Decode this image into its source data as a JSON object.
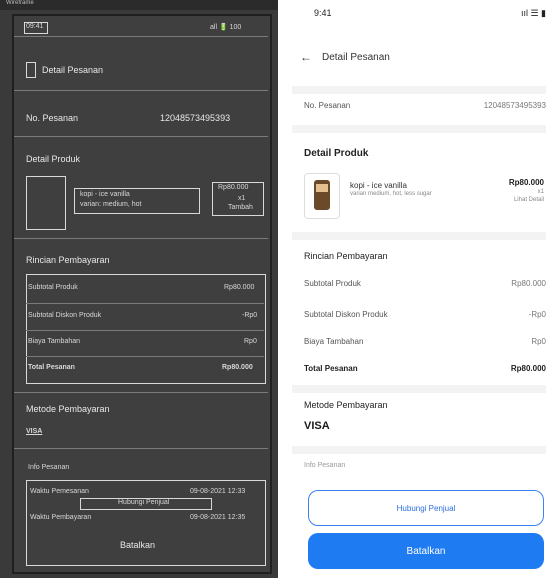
{
  "wire": {
    "status_time": "09:41",
    "status_icons": "all 🔋 100",
    "header_title": "Detail Pesanan",
    "no_pesanan_label": "No. Pesanan",
    "no_pesanan_value": "12048573495393",
    "detail_produk": "Detail Produk",
    "product_name": "kopi - ice vanilla",
    "product_sub": "varian: medium, hot",
    "product_price": "Rp80.000",
    "product_qty": "x1",
    "product_more": "Tambah",
    "rincian": "Rincian Pembayaran",
    "rows": [
      {
        "label": "Subtotal Produk",
        "value": "Rp80.000"
      },
      {
        "label": "Subtotal Diskon Produk",
        "value": "-Rp0"
      },
      {
        "label": "Biaya Tambahan",
        "value": "Rp0"
      },
      {
        "label": "Total Pesanan",
        "value": "Rp80.000"
      }
    ],
    "metode": "Metode Pembayaran",
    "metode_value": "VISA",
    "info": "Info Pesanan",
    "waktu_pesan_label": "Waktu Pemesanan",
    "waktu_pesan_value": "09-08-2021 12:33",
    "waktu_bayar_label": "Waktu Pembayaran",
    "waktu_bayar_value": "09-08-2021 12:35",
    "hubungi": "Hubungi Penjual",
    "batal": "Batalkan"
  },
  "phone": {
    "status_time": "9:41",
    "status_icons": "ııl ☰ ▮",
    "back": "←",
    "title": "Detail Pesanan",
    "no_label": "No. Pesanan",
    "no_value": "12048573495393",
    "detail_produk": "Detail Produk",
    "product_name": "kopi - ice vanilla",
    "product_sub": "varian medium, hot, less sugar",
    "product_price": "Rp80.000",
    "product_qty": "x1",
    "product_more": "Lihat Detail",
    "rincian": "Rincian Pembayaran",
    "rows": [
      {
        "label": "Subtotal Produk",
        "value": "Rp80.000"
      },
      {
        "label": "Subtotal Diskon Produk",
        "value": "-Rp0"
      },
      {
        "label": "Biaya Tambahan",
        "value": "Rp0"
      },
      {
        "label": "Total Pesanan",
        "value": "Rp80.000"
      }
    ],
    "metode": "Metode Pembayaran",
    "metode_value": "VISA",
    "info": "Info Pesanan",
    "outline_btn": "Hubungi Penjual",
    "solid_btn": "Batalkan"
  }
}
